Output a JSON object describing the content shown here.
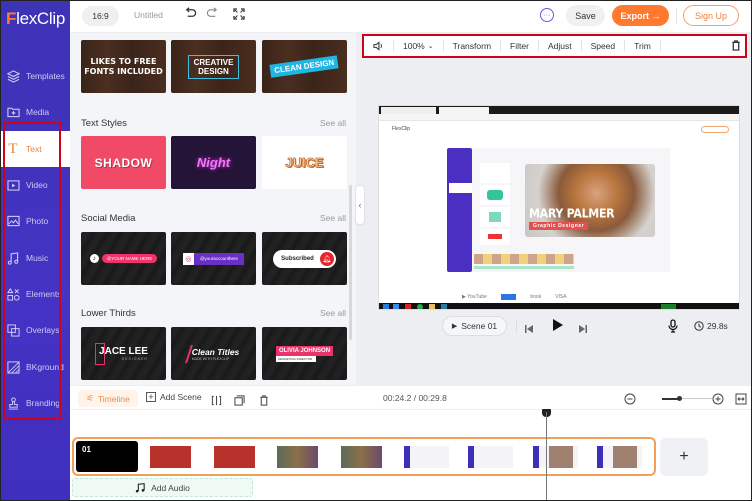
{
  "app": {
    "logo_prefix": "F",
    "logo_rest": "lexClip"
  },
  "topbar": {
    "aspect_ratio": "16:9",
    "project_title": "Untitled",
    "undo_icon": "undo-icon",
    "redo_icon": "redo-icon",
    "fullscreen_icon": "fullscreen-icon",
    "feedback_icon": "chat-icon",
    "save_label": "Save",
    "export_label": "Export →",
    "signup_label": "Sign Up"
  },
  "sidebar": {
    "items": [
      {
        "label": "Templates",
        "icon": "layers-icon"
      },
      {
        "label": "Media",
        "icon": "folder-plus-icon"
      },
      {
        "label": "Text",
        "icon": "text-icon",
        "active": true
      },
      {
        "label": "Video",
        "icon": "video-icon"
      },
      {
        "label": "Photo",
        "icon": "photo-icon"
      },
      {
        "label": "Music",
        "icon": "music-icon"
      },
      {
        "label": "Elements",
        "icon": "shapes-icon"
      },
      {
        "label": "Overlays",
        "icon": "overlays-icon"
      },
      {
        "label": "BKground",
        "icon": "background-icon"
      },
      {
        "label": "Branding",
        "icon": "stamp-icon"
      }
    ]
  },
  "panel": {
    "top_row": [
      {
        "line1": "LIKES TO FREE",
        "line2": "FONTS INCLUDED"
      },
      {
        "line1": "CREATIVE",
        "line2": "DESIGN"
      },
      {
        "line1": "CLEAN DESIGN",
        "line2": ""
      }
    ],
    "sections": [
      {
        "title": "Text Styles",
        "see_all": "See all",
        "items": [
          "SHADOW",
          "Night",
          "JUICE"
        ]
      },
      {
        "title": "Social Media",
        "see_all": "See all",
        "items": [
          "@YOUR NAME HERE",
          "@youraccounthere",
          "Subscribed"
        ]
      },
      {
        "title": "Lower Thirds",
        "see_all": "See all",
        "items": [
          {
            "title": "JACE LEE",
            "sub": "DESIGNER"
          },
          {
            "title": "Clean Titles",
            "sub": "MADE WITH FLEXCLIP"
          },
          {
            "title": "OLIVIA JOHNSON",
            "sub": "MARKETING DIRECTOR"
          }
        ]
      }
    ]
  },
  "toolbar": {
    "volume_icon": "volume-icon",
    "zoom_value": "100%",
    "items": [
      "Transform",
      "Filter",
      "Adjust",
      "Speed",
      "Trim"
    ],
    "delete_icon": "trash-icon"
  },
  "preview": {
    "inner_logo": "FlexClip",
    "headline": "MARY PALMER",
    "subline": "Graphic Designer",
    "footer_text": "book",
    "footer_text2": "VISA"
  },
  "player": {
    "scene_label": "Scene 01",
    "duration": "29.8s"
  },
  "timeline": {
    "tab_label": "Timeline",
    "add_scene_label": "Add Scene",
    "time_current": "00:24.2",
    "time_total": "00:29.8",
    "time_readout": "00:24.2 / 00:29.8",
    "zoom_level": 0.35,
    "scene_number": "01",
    "add_audio_label": "Add Audio",
    "add_scene_plus": "+"
  }
}
